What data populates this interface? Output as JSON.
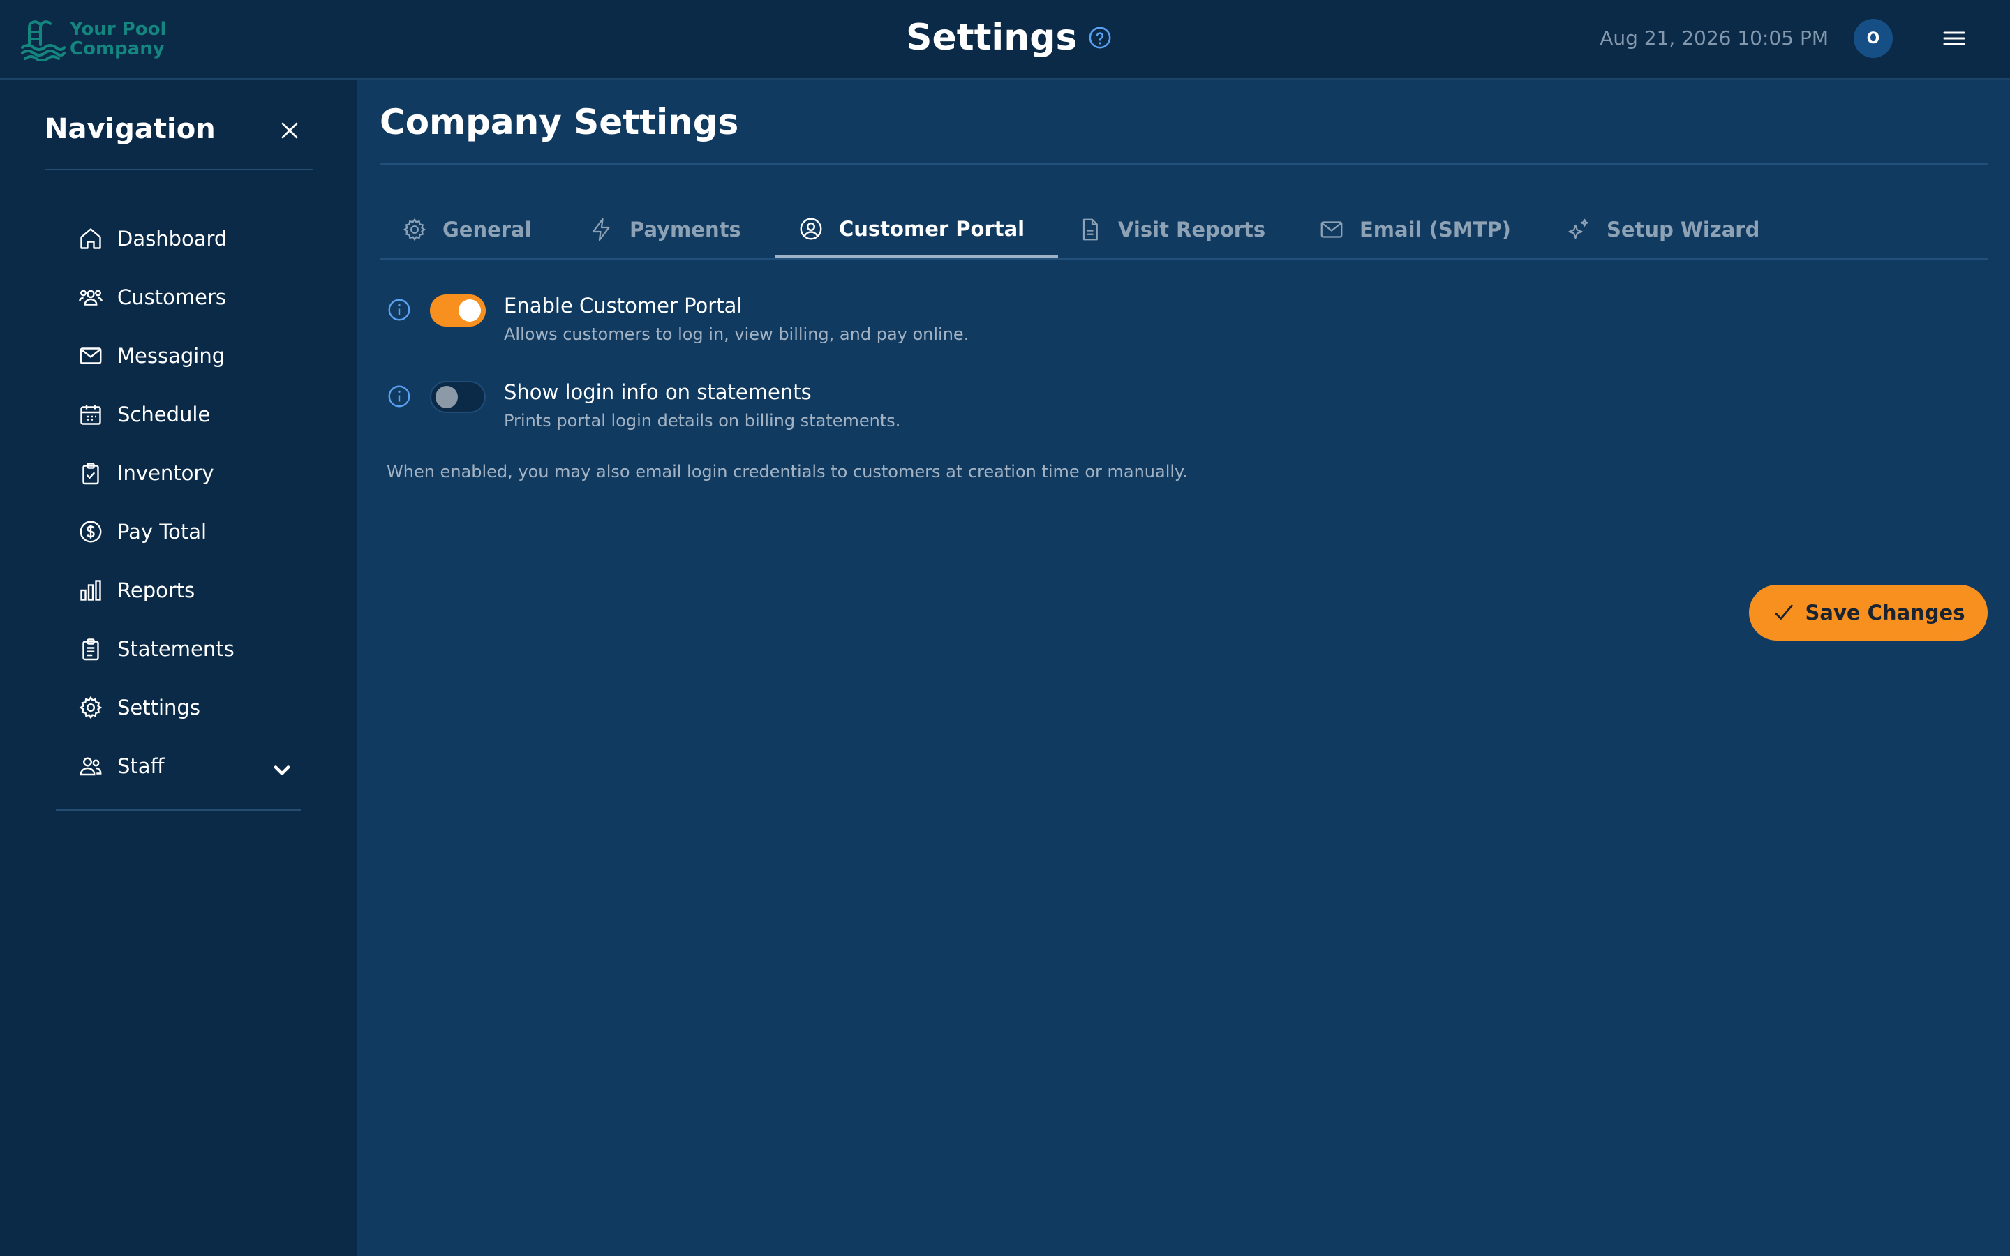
{
  "header": {
    "logo_line1": "Your Pool",
    "logo_line2": "Company",
    "title": "Settings",
    "datetime": "Aug 21, 2026 10:05 PM",
    "avatar_initial": "O"
  },
  "sidebar": {
    "title": "Navigation",
    "items": [
      {
        "label": "Dashboard",
        "icon": "home-icon"
      },
      {
        "label": "Customers",
        "icon": "users-icon"
      },
      {
        "label": "Messaging",
        "icon": "mail-icon"
      },
      {
        "label": "Schedule",
        "icon": "calendar-icon"
      },
      {
        "label": "Inventory",
        "icon": "clipboard-check-icon"
      },
      {
        "label": "Pay Total",
        "icon": "dollar-circle-icon"
      },
      {
        "label": "Reports",
        "icon": "bar-chart-icon"
      },
      {
        "label": "Statements",
        "icon": "clipboard-list-icon"
      },
      {
        "label": "Settings",
        "icon": "gear-icon"
      },
      {
        "label": "Staff",
        "icon": "staff-icon"
      }
    ]
  },
  "main": {
    "title": "Company Settings",
    "tabs": [
      {
        "label": "General",
        "icon": "gear-icon"
      },
      {
        "label": "Payments",
        "icon": "lightning-icon"
      },
      {
        "label": "Customer Portal",
        "icon": "user-circle-icon",
        "active": true
      },
      {
        "label": "Visit Reports",
        "icon": "document-icon"
      },
      {
        "label": "Email (SMTP)",
        "icon": "envelope-icon"
      },
      {
        "label": "Setup Wizard",
        "icon": "sparkles-icon"
      }
    ],
    "settings": [
      {
        "label": "Enable Customer Portal",
        "description": "Allows customers to log in, view billing, and pay online.",
        "enabled": true
      },
      {
        "label": "Show login info on statements",
        "description": "Prints portal login details on billing statements.",
        "enabled": false
      }
    ],
    "note": "When enabled, you may also email login credentials to customers at creation time or manually.",
    "save_label": "Save Changes"
  },
  "colors": {
    "background": "#113a60",
    "sidebar": "#0b2a47",
    "accent": "#f7901e",
    "logo": "#14857f"
  }
}
